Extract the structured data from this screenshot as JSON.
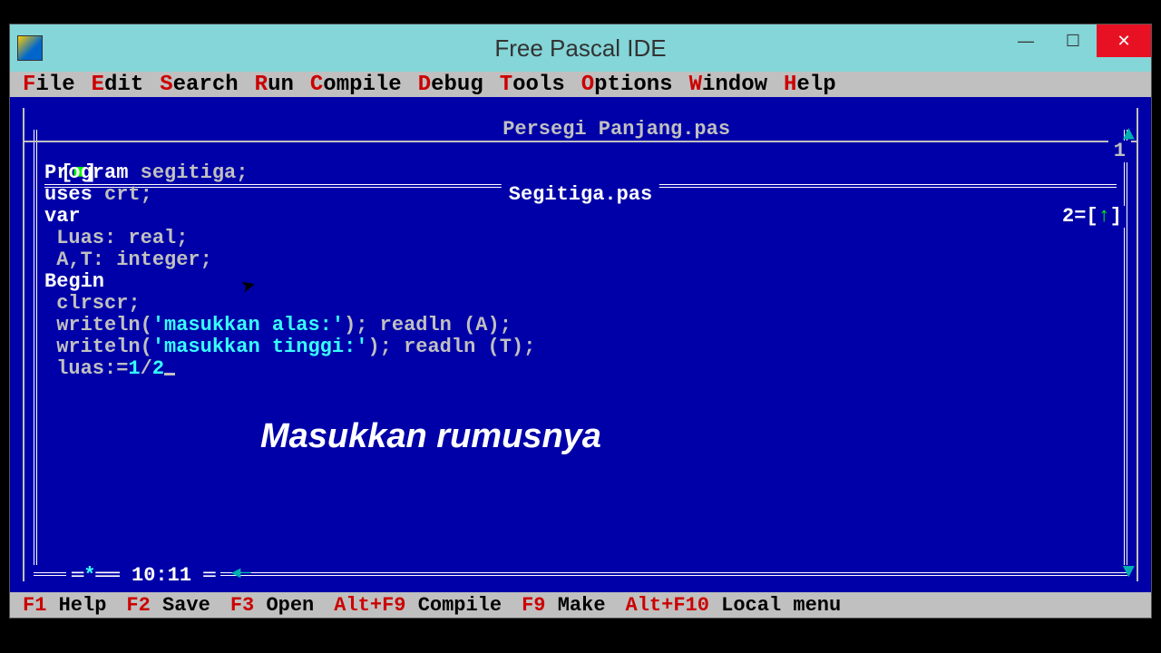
{
  "window": {
    "title": "Free Pascal IDE"
  },
  "menu": {
    "file": "File",
    "edit": "Edit",
    "search": "Search",
    "run": "Run",
    "compile": "Compile",
    "debug": "Debug",
    "tools": "Tools",
    "options": "Options",
    "window": "Window",
    "help": "Help"
  },
  "tabs": {
    "back": "Persegi Panjang.pas",
    "back_num": "1",
    "front": "Segitiga.pas",
    "front_num": "2"
  },
  "code": {
    "l1a": "Program ",
    "l1b": "segitiga",
    "l1c": ";",
    "l2a": "uses ",
    "l2b": "crt;",
    "l3": "var",
    "l4": " Luas: real;",
    "l5": " A,T: integer;",
    "l6": "Begin",
    "l7": " clrscr;",
    "l8a": " writeln(",
    "l8b": "'masukkan alas:'",
    "l8c": "); readln (A);",
    "l9a": " writeln(",
    "l9b": "'masukkan tinggi:'",
    "l9c": "); readln (T);",
    "l10a": " luas:=",
    "l10b": "1",
    "l10c": "/",
    "l10d": "2"
  },
  "overlay": {
    "text": "Masukkan rumusnya"
  },
  "cursor": {
    "line_col": "10:11",
    "modified": "*"
  },
  "status": {
    "f1k": "F1",
    "f1": "Help",
    "f2k": "F2",
    "f2": "Save",
    "f3k": "F3",
    "f3": "Open",
    "af9k": "Alt+F9",
    "af9": "Compile",
    "f9k": "F9",
    "f9": "Make",
    "af10k": "Alt+F10",
    "af10": "Local menu"
  }
}
